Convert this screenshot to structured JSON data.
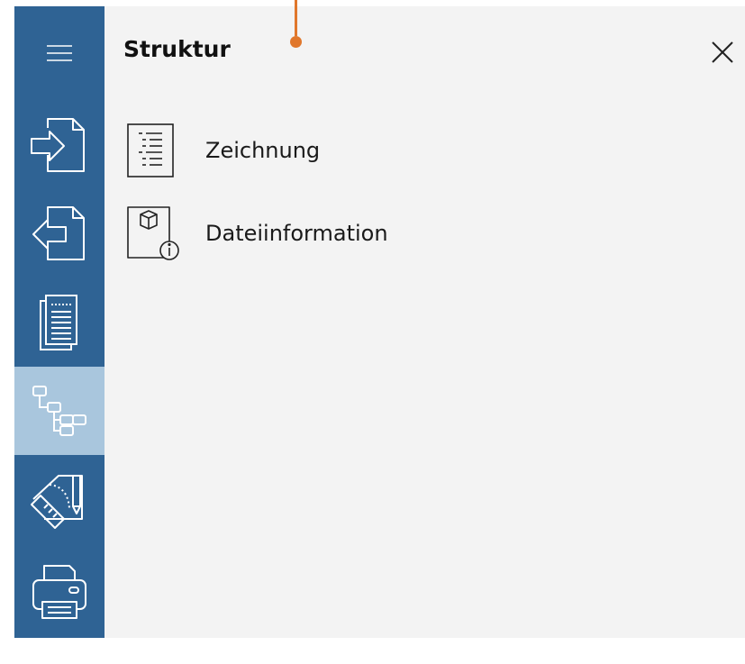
{
  "sidebar": {
    "items": [
      {
        "icon": "hamburger-menu-icon"
      },
      {
        "icon": "file-import-icon"
      },
      {
        "icon": "file-export-icon"
      },
      {
        "icon": "document-pages-icon"
      },
      {
        "icon": "structure-tree-icon",
        "active": true
      },
      {
        "icon": "measure-drawing-icon"
      },
      {
        "icon": "printer-icon"
      }
    ],
    "background": "#2f6394",
    "active_background": "#a9c6dd"
  },
  "panel": {
    "title": "Struktur",
    "close_icon": "close-icon",
    "background": "#f3f3f3",
    "items": [
      {
        "label": "Zeichnung",
        "icon": "drawing-list-icon"
      },
      {
        "label": "Dateiinformation",
        "icon": "file-info-icon"
      }
    ]
  },
  "marker": {
    "color": "#e0772c"
  }
}
